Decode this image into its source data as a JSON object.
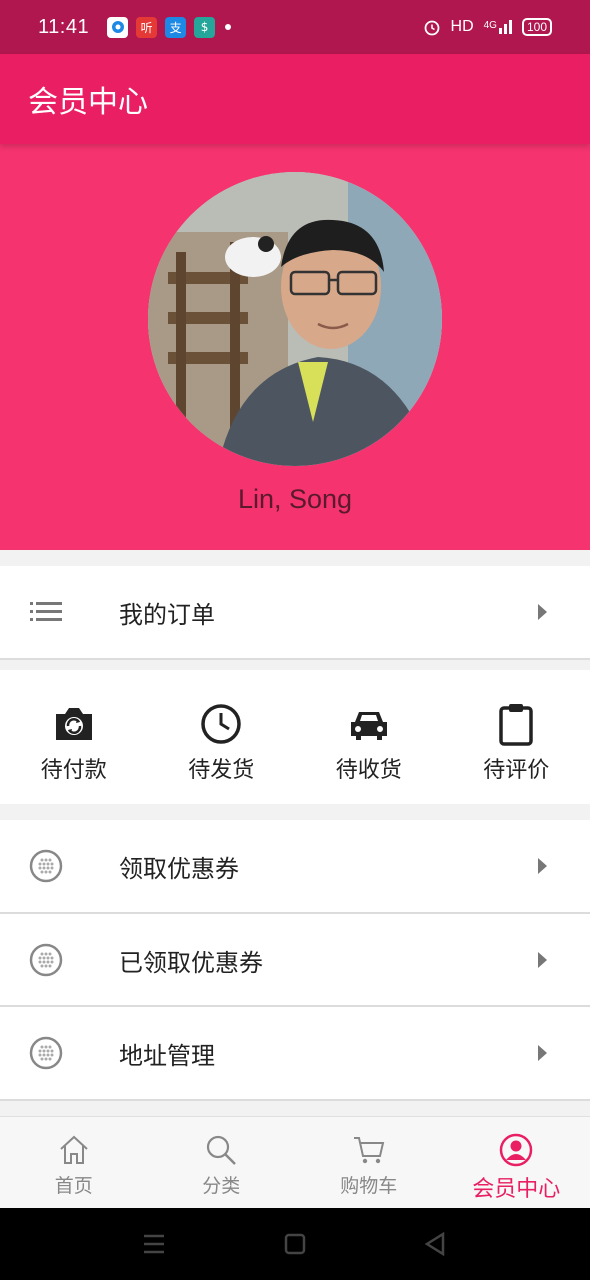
{
  "status_bar": {
    "time": "11:41",
    "apps": [
      {
        "icon": "circle-app-icon",
        "color": "#ffffff",
        "glyph": "◉"
      },
      {
        "icon": "ting-app-icon",
        "color": "#e53935",
        "glyph": "听"
      },
      {
        "icon": "alipay-app-icon",
        "color": "#1e88e5",
        "glyph": "支"
      },
      {
        "icon": "green-app-icon",
        "color": "#26a69a",
        "glyph": "$"
      }
    ],
    "hd": "HD",
    "network": "4G",
    "battery": "100"
  },
  "appbar": {
    "title": "会员中心"
  },
  "profile": {
    "username": "Lin, Song"
  },
  "my_orders": {
    "label": "我的订单"
  },
  "order_status": [
    {
      "label": "待付款",
      "icon": "camera-icon"
    },
    {
      "label": "待发货",
      "icon": "clock-icon"
    },
    {
      "label": "待收货",
      "icon": "car-icon"
    },
    {
      "label": "待评价",
      "icon": "clipboard-icon"
    }
  ],
  "menu": [
    {
      "label": "领取优惠券",
      "icon": "dots-circle-icon"
    },
    {
      "label": "已领取优惠券",
      "icon": "dots-circle-icon"
    },
    {
      "label": "地址管理",
      "icon": "dots-circle-icon"
    }
  ],
  "bottom_nav": [
    {
      "label": "首页",
      "icon": "home-icon",
      "active": false
    },
    {
      "label": "分类",
      "icon": "search-icon",
      "active": false
    },
    {
      "label": "购物车",
      "icon": "cart-icon",
      "active": false
    },
    {
      "label": "会员中心",
      "icon": "user-icon",
      "active": true
    }
  ],
  "colors": {
    "status_bar": "#b0174e",
    "appbar": "#e91e63",
    "profile_bg": "#f5336e",
    "accent": "#e91e63"
  }
}
